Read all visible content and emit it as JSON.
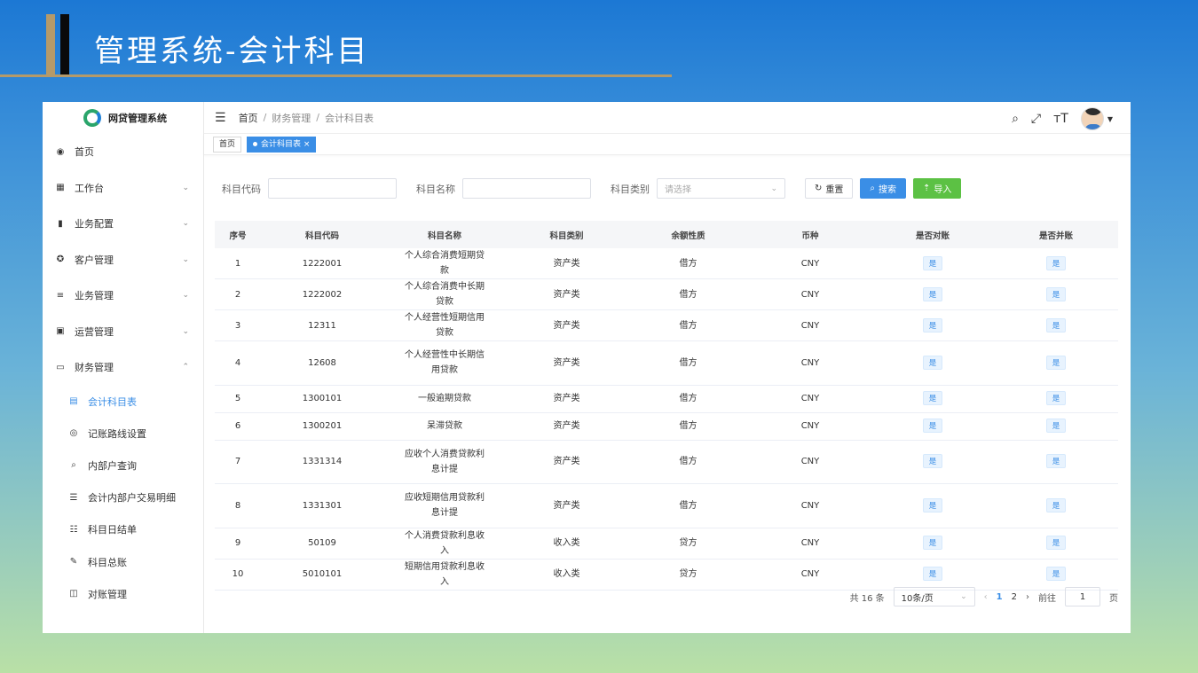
{
  "slide": {
    "title": "管理系统-会计科目"
  },
  "app": {
    "logo_text": "网贷管理系统",
    "menu": [
      {
        "label": "首页",
        "icon": "dashboard-icon",
        "glyph": "◉",
        "chev": ""
      },
      {
        "label": "工作台",
        "icon": "table-icon",
        "glyph": "▦",
        "chev": "⌄"
      },
      {
        "label": "业务配置",
        "icon": "book-icon",
        "glyph": "▮",
        "chev": "⌄"
      },
      {
        "label": "客户管理",
        "icon": "circle-icon",
        "glyph": "✪",
        "chev": "⌄"
      },
      {
        "label": "业务管理",
        "icon": "sliders-icon",
        "glyph": "≡",
        "chev": "⌄"
      },
      {
        "label": "运营管理",
        "icon": "copy-icon",
        "glyph": "▣",
        "chev": "⌄"
      },
      {
        "label": "财务管理",
        "icon": "monitor-icon",
        "glyph": "▭",
        "chev": "⌃"
      }
    ],
    "submenu": [
      {
        "label": "会计科目表",
        "icon": "list-icon",
        "glyph": "▤"
      },
      {
        "label": "记账路线设置",
        "icon": "route-icon",
        "glyph": "◎"
      },
      {
        "label": "内部户查询",
        "icon": "search-icon",
        "glyph": "⌕"
      },
      {
        "label": "会计内部户交易明细",
        "icon": "list-ul-icon",
        "glyph": "☰"
      },
      {
        "label": "科目日结单",
        "icon": "list-ol-icon",
        "glyph": "☷"
      },
      {
        "label": "科目总账",
        "icon": "edit-icon",
        "glyph": "✎"
      },
      {
        "label": "对账管理",
        "icon": "book-open-icon",
        "glyph": "◫"
      }
    ],
    "breadcrumb": [
      "首页",
      "财务管理",
      "会计科目表"
    ],
    "tags": {
      "home": "首页",
      "active": "会计科目表"
    },
    "filters": {
      "code_label": "科目代码",
      "name_label": "科目名称",
      "type_label": "科目类别",
      "type_placeholder": "请选择",
      "reset": "重置",
      "search": "搜索",
      "import": "导入"
    },
    "table": {
      "headers": [
        "序号",
        "科目代码",
        "科目名称",
        "科目类别",
        "余额性质",
        "币种",
        "是否对账",
        "是否并账"
      ],
      "rows": [
        {
          "idx": "1",
          "code": "1222001",
          "name": "个人综合消费短期贷款",
          "type": "资产类",
          "nature": "借方",
          "currency": "CNY",
          "reconcile": "是",
          "merge": "是",
          "tall": false
        },
        {
          "idx": "2",
          "code": "1222002",
          "name": "个人综合消费中长期贷款",
          "type": "资产类",
          "nature": "借方",
          "currency": "CNY",
          "reconcile": "是",
          "merge": "是",
          "tall": false
        },
        {
          "idx": "3",
          "code": "12311",
          "name": "个人经营性短期信用贷款",
          "type": "资产类",
          "nature": "借方",
          "currency": "CNY",
          "reconcile": "是",
          "merge": "是",
          "tall": false
        },
        {
          "idx": "4",
          "code": "12608",
          "name": "个人经营性中长期信用贷款",
          "type": "资产类",
          "nature": "借方",
          "currency": "CNY",
          "reconcile": "是",
          "merge": "是",
          "tall": true
        },
        {
          "idx": "5",
          "code": "1300101",
          "name": "一般逾期贷款",
          "type": "资产类",
          "nature": "借方",
          "currency": "CNY",
          "reconcile": "是",
          "merge": "是",
          "tall": false
        },
        {
          "idx": "6",
          "code": "1300201",
          "name": "呆滞贷款",
          "type": "资产类",
          "nature": "借方",
          "currency": "CNY",
          "reconcile": "是",
          "merge": "是",
          "tall": false
        },
        {
          "idx": "7",
          "code": "1331314",
          "name": "应收个人消费贷款利息计提",
          "type": "资产类",
          "nature": "借方",
          "currency": "CNY",
          "reconcile": "是",
          "merge": "是",
          "tall": true
        },
        {
          "idx": "8",
          "code": "1331301",
          "name": "应收短期信用贷款利息计提",
          "type": "资产类",
          "nature": "借方",
          "currency": "CNY",
          "reconcile": "是",
          "merge": "是",
          "tall": true
        },
        {
          "idx": "9",
          "code": "50109",
          "name": "个人消费贷款利息收入",
          "type": "收入类",
          "nature": "贷方",
          "currency": "CNY",
          "reconcile": "是",
          "merge": "是",
          "tall": false
        },
        {
          "idx": "10",
          "code": "5010101",
          "name": "短期信用贷款利息收入",
          "type": "收入类",
          "nature": "贷方",
          "currency": "CNY",
          "reconcile": "是",
          "merge": "是",
          "tall": false
        }
      ]
    },
    "pager": {
      "total": "共 16 条",
      "page_size": "10条/页",
      "prev": "‹",
      "pages": [
        "1",
        "2"
      ],
      "next": "›",
      "jump_label": "前往",
      "jump_value": "1",
      "page_unit": "页"
    }
  }
}
